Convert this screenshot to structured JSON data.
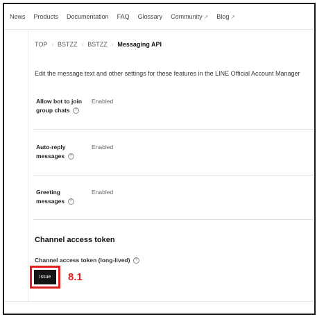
{
  "nav": {
    "items": [
      {
        "label": "News",
        "external": false
      },
      {
        "label": "Products",
        "external": false
      },
      {
        "label": "Documentation",
        "external": false
      },
      {
        "label": "FAQ",
        "external": false
      },
      {
        "label": "Glossary",
        "external": false
      },
      {
        "label": "Community",
        "external": true
      },
      {
        "label": "Blog",
        "external": true
      }
    ],
    "external_glyph": "↗"
  },
  "breadcrumb": {
    "items": [
      "TOP",
      "BSTZZ",
      "BSTZZ",
      "Messaging API"
    ],
    "separator": "›"
  },
  "description": "Edit the message text and other settings for these features in the LINE Official Account Manager",
  "settings": [
    {
      "label": "Allow bot to join group chats",
      "value": "Enabled"
    },
    {
      "label": "Auto-reply messages",
      "value": "Enabled"
    },
    {
      "label": "Greeting messages",
      "value": "Enabled"
    }
  ],
  "help_glyph": "?",
  "channel_access_token": {
    "section_title": "Channel access token",
    "field_label": "Channel access token (long-lived)",
    "issue_button_label": "Issue"
  },
  "annotation": {
    "step_label": "8.1",
    "color": "#e02020"
  }
}
